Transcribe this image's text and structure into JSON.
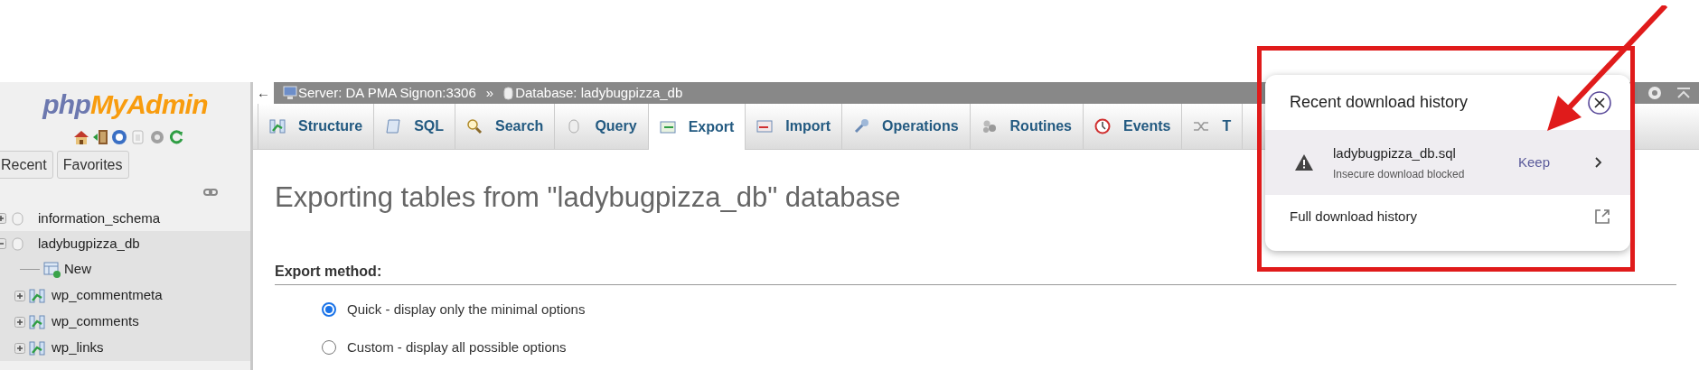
{
  "logo": {
    "part1": "php",
    "part2": "MyAdmin"
  },
  "nav_tabs": [
    {
      "label": "Recent",
      "selected": false
    },
    {
      "label": "Favorites",
      "selected": false
    }
  ],
  "tree": [
    {
      "label": "information_schema",
      "expanded": false,
      "selected": false
    },
    {
      "label": "ladybugpizza_db",
      "expanded": true,
      "selected": true,
      "children": [
        {
          "label": "New",
          "kind": "new"
        },
        {
          "label": "wp_commentmeta",
          "kind": "table"
        },
        {
          "label": "wp_comments",
          "kind": "table"
        },
        {
          "label": "wp_links",
          "kind": "table"
        }
      ]
    }
  ],
  "breadcrumb": {
    "back": "←",
    "server": "Server: DA PMA Signon:3306",
    "separator": "»",
    "database": "Database: ladybugpizza_db"
  },
  "tabs": [
    {
      "label": "Structure",
      "selected": false
    },
    {
      "label": "SQL",
      "selected": false
    },
    {
      "label": "Search",
      "selected": false
    },
    {
      "label": "Query",
      "selected": false
    },
    {
      "label": "Export",
      "selected": true
    },
    {
      "label": "Import",
      "selected": false
    },
    {
      "label": "Operations",
      "selected": false
    },
    {
      "label": "Routines",
      "selected": false
    },
    {
      "label": "Events",
      "selected": false
    },
    {
      "label": "T",
      "selected": false
    }
  ],
  "heading": "Exporting tables from \"ladybugpizza_db\" database",
  "export_method": {
    "label": "Export method:",
    "options": [
      {
        "label": "Quick - display only the minimal options",
        "selected": true
      },
      {
        "label": "Custom - display all possible options",
        "selected": false
      }
    ]
  },
  "download_popup": {
    "title": "Recent download history",
    "items": [
      {
        "filename": "ladybugpizza_db.sql",
        "status": "Insecure download blocked",
        "action": "Keep"
      }
    ],
    "footer": "Full download history"
  }
}
